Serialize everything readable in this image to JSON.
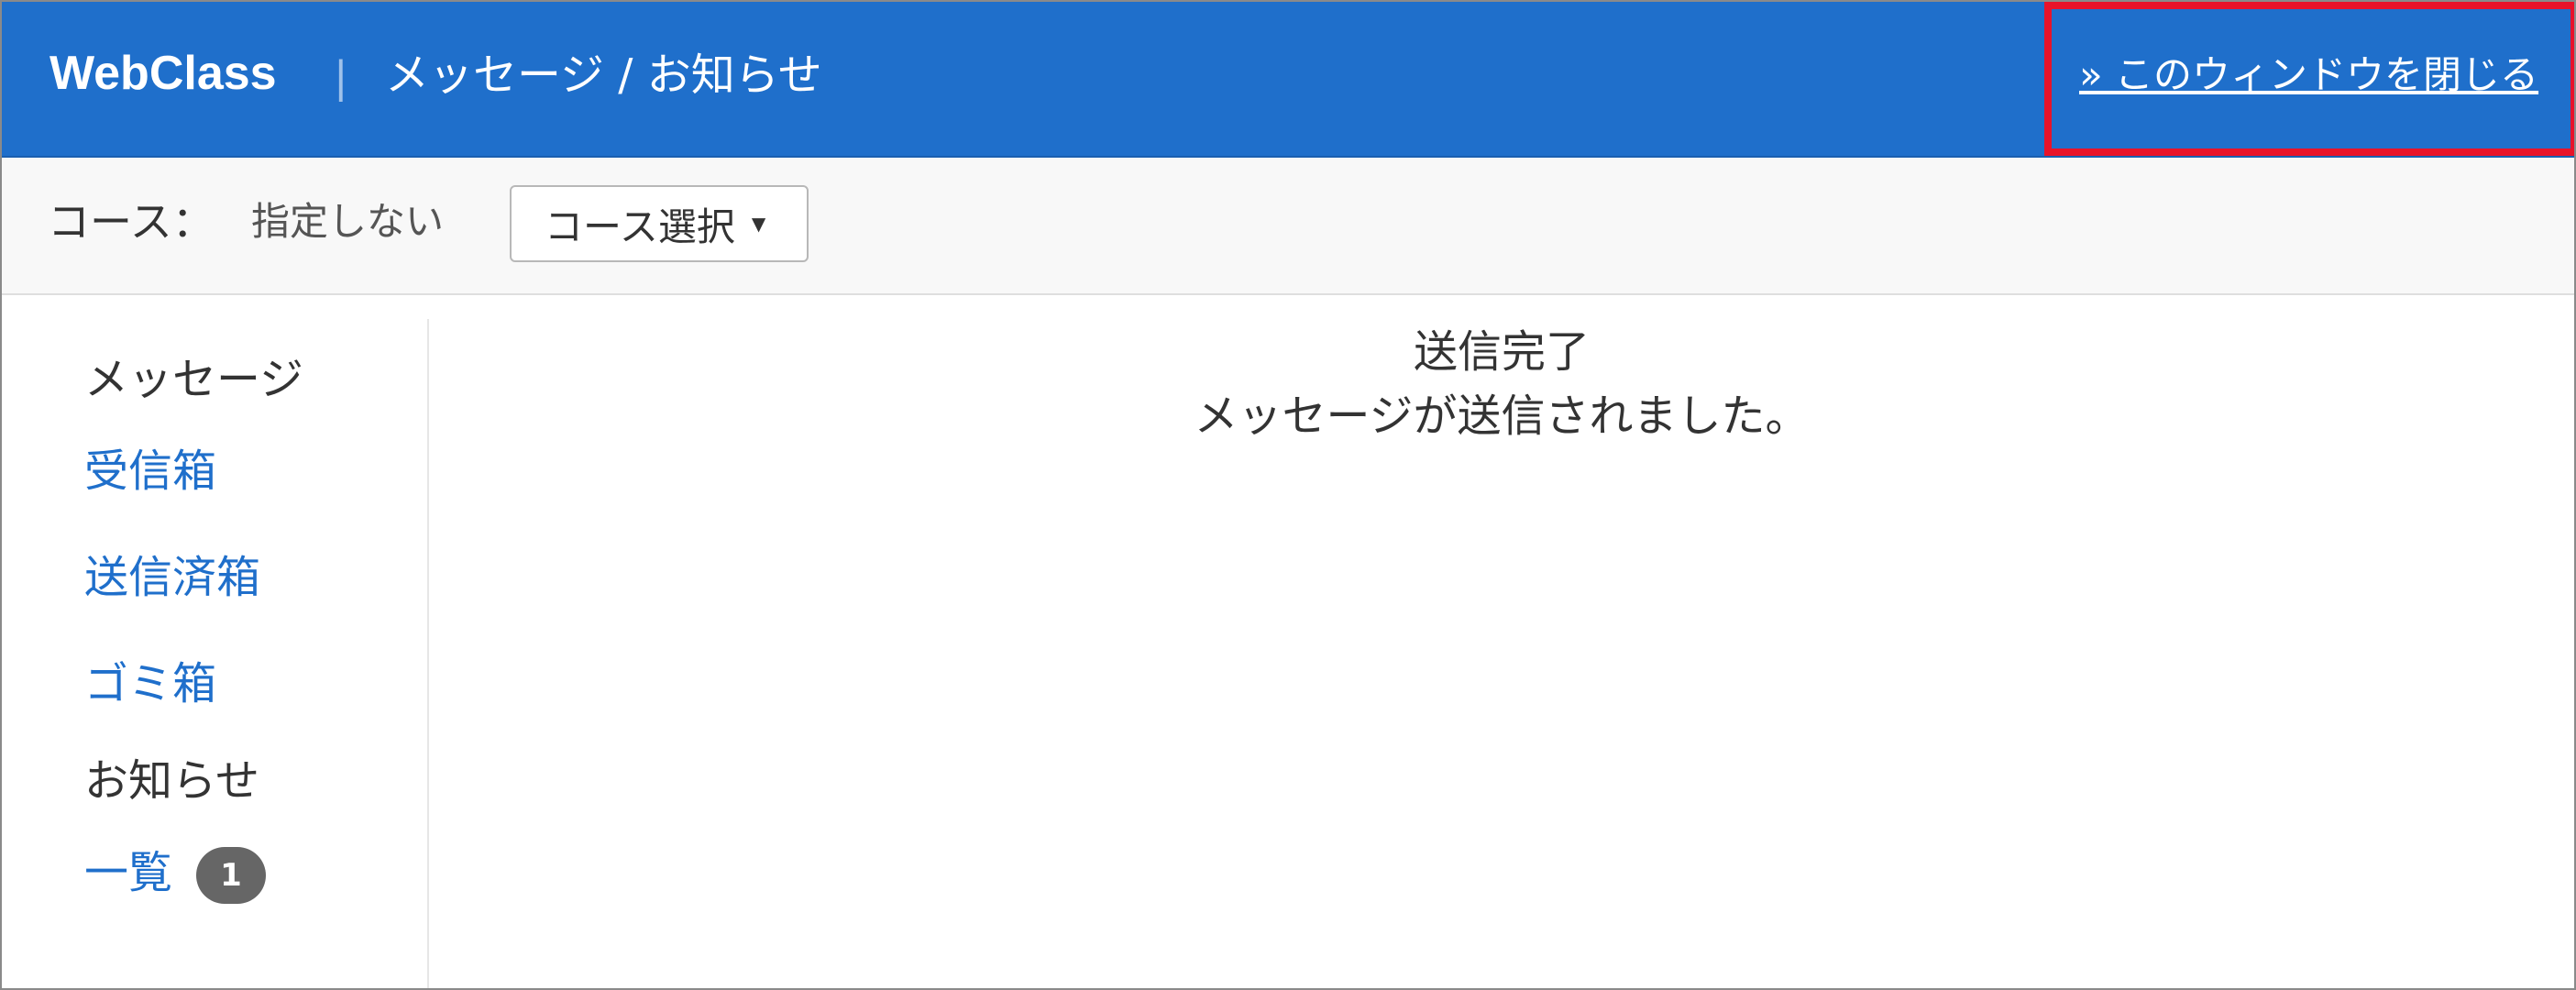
{
  "header": {
    "brand": "WebClass",
    "separator": "|",
    "title": "メッセージ / お知らせ",
    "close_link": "» このウィンドウを閉じる",
    "background_color": "#1f6fcb",
    "highlight_color": "#e8132a"
  },
  "course_bar": {
    "label": "コース：",
    "value": "指定しない",
    "select_button": "コース選択",
    "caret_icon": "triangle-down"
  },
  "sidebar": {
    "message_heading": "メッセージ",
    "inbox": "受信箱",
    "sent": "送信済箱",
    "trash": "ゴミ箱",
    "notice_heading": "お知らせ",
    "notice_list": "一覧",
    "notice_count": "1"
  },
  "main": {
    "status_title": "送信完了",
    "status_message": "メッセージが送信されました。"
  }
}
